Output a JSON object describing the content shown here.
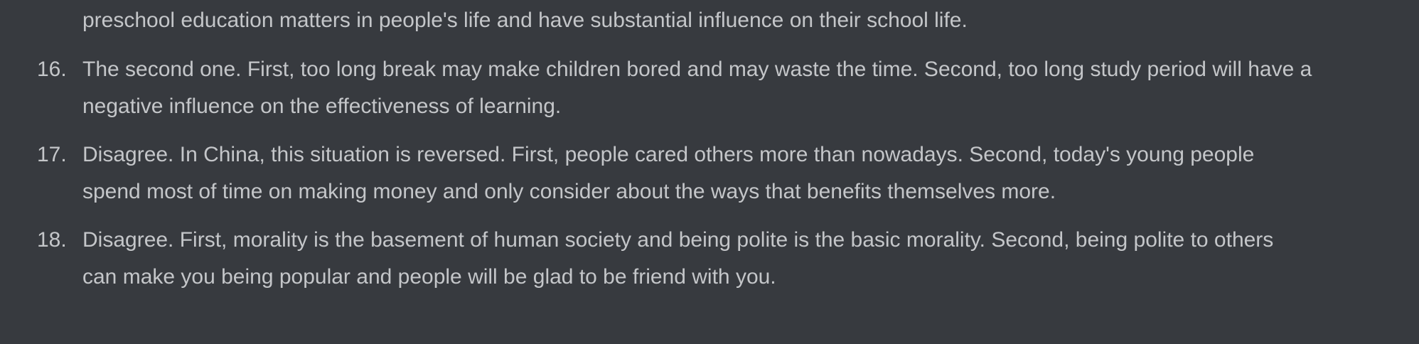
{
  "intro": {
    "text": "preschool education matters in people's life and have substantial influence on their school life."
  },
  "items": [
    {
      "number": "16.",
      "lines": [
        "The second one. First, too long break may make children bored and may waste the time. Second, too long study period will have a",
        "negative influence on the effectiveness of learning."
      ]
    },
    {
      "number": "17.",
      "lines": [
        "Disagree. In China, this situation is reversed. First, people cared others more than nowadays. Second, today's young people",
        "spend most of time on making money and only consider about the ways that benefits themselves more."
      ]
    },
    {
      "number": "18.",
      "lines": [
        "Disagree. First, morality is the basement of human society and being polite is the basic morality. Second, being polite to others",
        "can make you being popular and people will be glad to be friend with you."
      ]
    }
  ]
}
